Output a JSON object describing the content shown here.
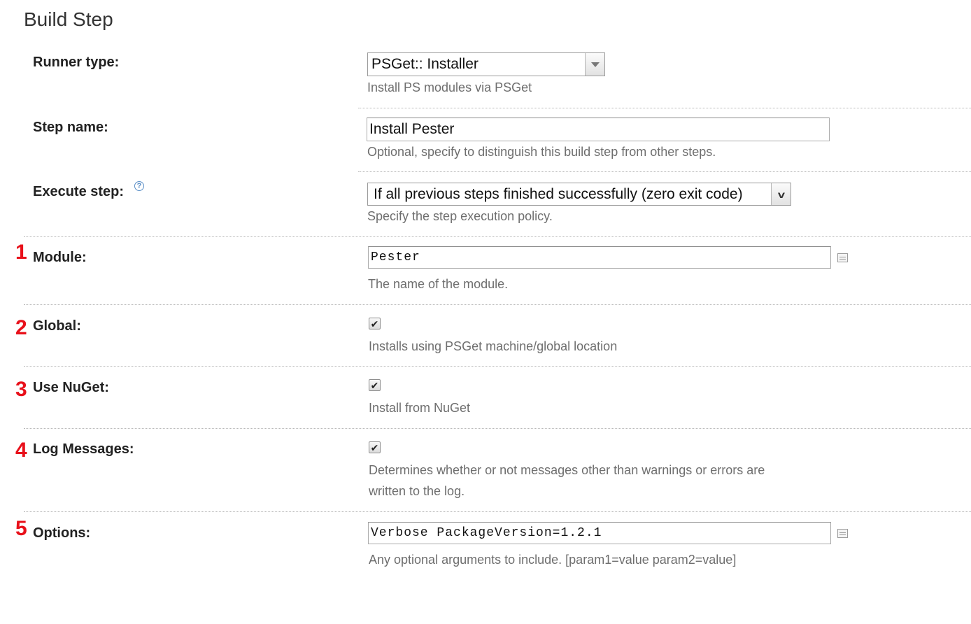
{
  "section_title": "Build Step",
  "runner_type": {
    "label": "Runner type:",
    "value": "PSGet:: Installer",
    "help": "Install PS modules via PSGet"
  },
  "step_name": {
    "label": "Step name:",
    "value": "Install Pester",
    "help": "Optional, specify to distinguish this build step from other steps."
  },
  "execute_step": {
    "label": "Execute step:",
    "help_icon": "?",
    "value": "If all previous steps finished successfully (zero exit code)",
    "help": "Specify the step execution policy."
  },
  "module": {
    "marker": "1",
    "label": "Module:",
    "value": "Pester",
    "help": "The name of the module."
  },
  "global": {
    "marker": "2",
    "label": "Global:",
    "checked": true,
    "check_glyph": "✔",
    "help": "Installs using PSGet machine/global location"
  },
  "use_nuget": {
    "marker": "3",
    "label": "Use NuGet:",
    "checked": true,
    "check_glyph": "✔",
    "help": "Install from NuGet"
  },
  "log_messages": {
    "marker": "4",
    "label": "Log Messages:",
    "checked": true,
    "check_glyph": "✔",
    "help_line1": "Determines whether or not messages other than warnings or errors are",
    "help_line2": "written to the log."
  },
  "options": {
    "marker": "5",
    "label": "Options:",
    "value": "Verbose PackageVersion=1.2.1",
    "help": "Any optional arguments to include. [param1=value param2=value]"
  },
  "colors": {
    "marker": "#e8101a",
    "help_text": "#6e6e6e",
    "separator": "#b8b8b8"
  }
}
